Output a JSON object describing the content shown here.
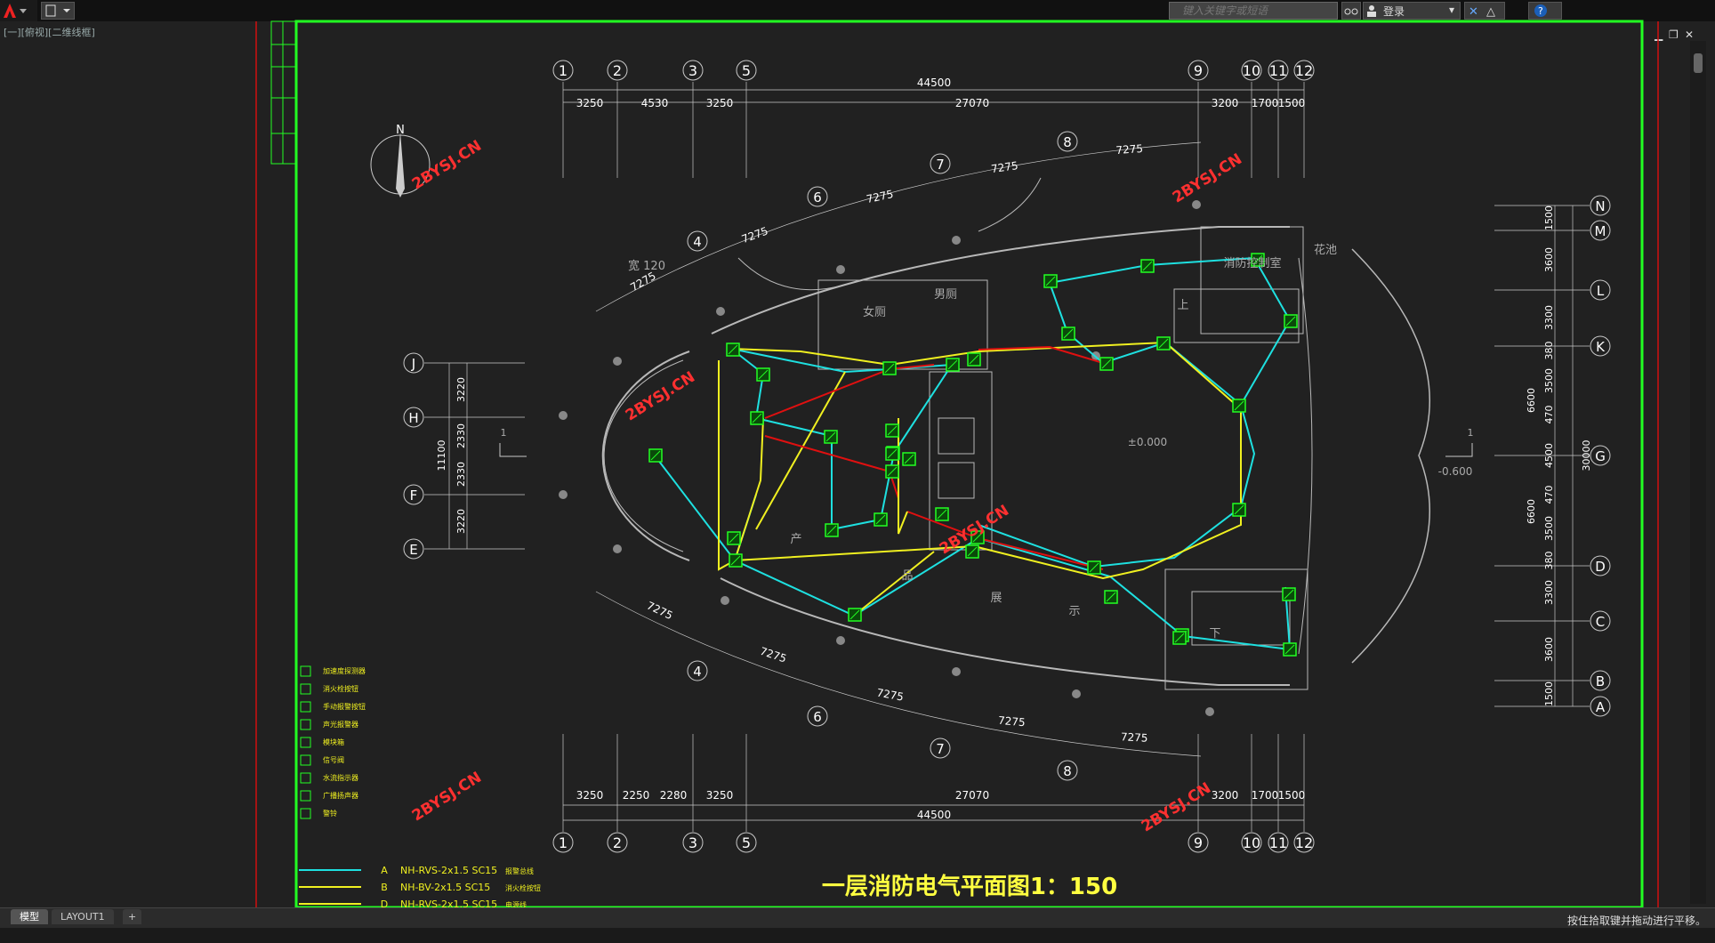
{
  "toolbar": {
    "search_placeholder": "键入关键字或短语",
    "login_label": "登录",
    "help_label": "?"
  },
  "viewport": {
    "label": "[一][俯视][二维线框]"
  },
  "tabs": [
    {
      "label": "模型"
    },
    {
      "label": "LAYOUT1"
    },
    {
      "label": "+"
    }
  ],
  "status": {
    "message": "按住拾取键并拖动进行平移。"
  },
  "drawing": {
    "title": "一层消防电气平面图1：150",
    "watermark": "2BYSJ.CN",
    "north": "N",
    "grid_top": [
      "1",
      "2",
      "3",
      "5",
      "9",
      "10",
      "11",
      "12"
    ],
    "grid_mid": [
      "4",
      "6",
      "7",
      "8"
    ],
    "grid_right": [
      "N",
      "M",
      "L",
      "K",
      "G",
      "D",
      "C",
      "B",
      "A"
    ],
    "grid_left": [
      "J",
      "H",
      "F",
      "E"
    ],
    "dims_top": [
      "3250",
      "4530",
      "3250",
      "27070",
      "3200",
      "1700",
      "1500"
    ],
    "dims_bottom": [
      "3250",
      "2250",
      "2280",
      "3250",
      "27070",
      "3200",
      "1700",
      "1500"
    ],
    "total_width": "44500",
    "arc_dims": [
      "7275",
      "7275",
      "7275",
      "7275",
      "7275"
    ],
    "dims_right": [
      "1500",
      "3600",
      "3300",
      "380",
      "3500",
      "470",
      "4500",
      "470",
      "3500",
      "380",
      "3300",
      "3600",
      "1500"
    ],
    "dims_right_mid": [
      "6600",
      "6600"
    ],
    "dim_right_total": "30000",
    "dims_left": [
      "3220",
      "2330",
      "2330",
      "3220"
    ],
    "dim_left_total": "11100",
    "room_labels": [
      "男厕",
      "女厕",
      "消防控制室",
      "花池",
      "上",
      "下",
      "产",
      "品",
      "展",
      "示",
      "宽 120"
    ],
    "elevations": [
      "±0.000",
      "-0.600"
    ],
    "section_marks": [
      "1",
      "1"
    ],
    "legend_items": [
      "加速度探测器",
      "消火栓按钮",
      "手动报警按钮",
      "声光报警器",
      "模块箱",
      "信号阀",
      "水流指示器",
      "广播扬声器",
      "警铃"
    ],
    "cable_rows": [
      {
        "code": "A",
        "spec": "NH-RVS-2x1.5 SC15",
        "desc": "报警总线"
      },
      {
        "code": "B",
        "spec": "NH-BV-2x1.5 SC15",
        "desc": "消火栓按钮"
      },
      {
        "code": "D",
        "spec": "NH-RVS-2x1.5 SC15",
        "desc": "电源线"
      }
    ]
  },
  "colors": {
    "frame": "#22ff22",
    "red_border": "#d01010",
    "wire_cyan": "#1ee0e0",
    "wire_yellow": "#f0f020",
    "wire_red": "#e01010",
    "watermark": "#ff3030",
    "title_yellow": "#ffff40",
    "grid_line": "#c8c8c8"
  }
}
